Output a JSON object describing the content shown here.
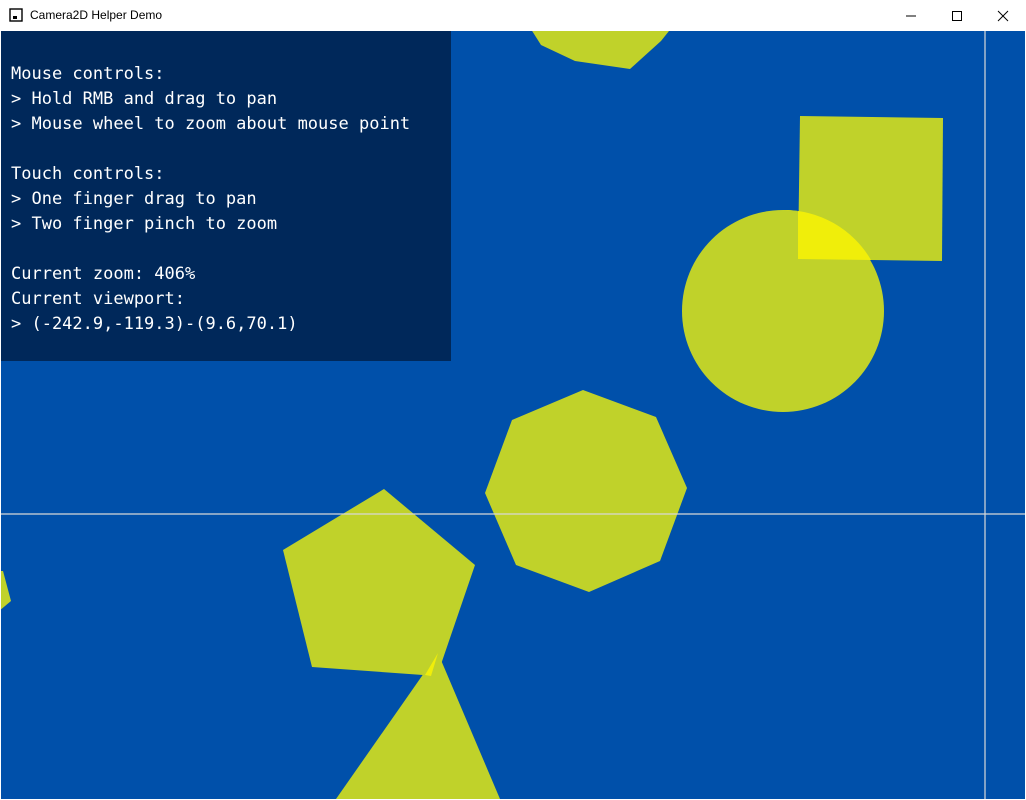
{
  "window": {
    "title": "Camera2D Helper Demo",
    "controls": {
      "minimize_icon": "minimize-icon",
      "maximize_icon": "maximize-icon",
      "close_icon": "close-icon"
    }
  },
  "colors": {
    "background": "#0050aa",
    "shape_fill": "#c0d22a",
    "overlap_fill": "#f0ee0a",
    "overlay_panel": "#00285a",
    "crosshair": "#d8d8d8"
  },
  "info_panel": {
    "mouse_heading": "Mouse controls:",
    "mouse_line1": "> Hold RMB and drag to pan",
    "mouse_line2": "> Mouse wheel to zoom about mouse point",
    "touch_heading": "Touch controls:",
    "touch_line1": "> One finger drag to pan",
    "touch_line2": "> Two finger pinch to zoom",
    "zoom_text": "Current zoom: 406%",
    "viewport_label": "Current viewport:",
    "viewport_value": "> (-242.9,-119.3)-(9.6,70.1)"
  }
}
